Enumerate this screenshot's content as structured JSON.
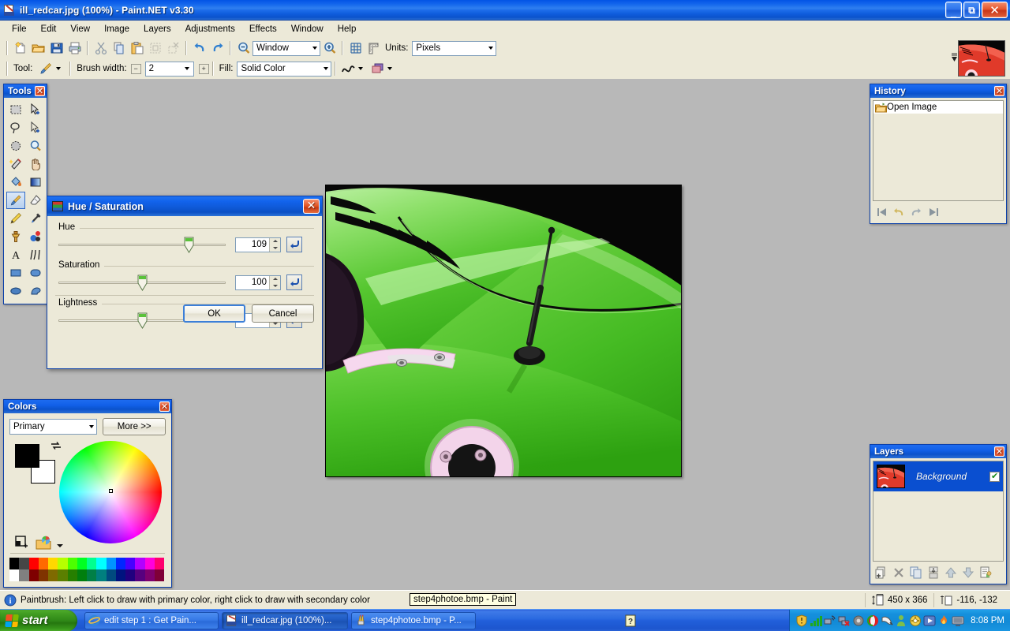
{
  "window": {
    "title": "ill_redcar.jpg (100%) - Paint.NET v3.30",
    "icon": "paintdotnet-icon",
    "minimize_label": "_",
    "maximize_label": "❐",
    "close_label": "✕"
  },
  "menu": {
    "items": [
      {
        "label": "File"
      },
      {
        "label": "Edit"
      },
      {
        "label": "View"
      },
      {
        "label": "Image"
      },
      {
        "label": "Layers"
      },
      {
        "label": "Adjustments"
      },
      {
        "label": "Effects"
      },
      {
        "label": "Window"
      },
      {
        "label": "Help"
      }
    ]
  },
  "toolbar_main": {
    "buttons": [
      {
        "name": "new-icon",
        "title": "New"
      },
      {
        "name": "open-icon",
        "title": "Open"
      },
      {
        "name": "save-icon",
        "title": "Save"
      },
      {
        "name": "print-icon",
        "title": "Print"
      },
      {
        "name": "cut-icon",
        "title": "Cut"
      },
      {
        "name": "copy-icon",
        "title": "Copy"
      },
      {
        "name": "paste-icon",
        "title": "Paste"
      },
      {
        "name": "crop-icon",
        "title": "Crop to Selection"
      },
      {
        "name": "deselect-icon",
        "title": "Deselect"
      },
      {
        "name": "undo-icon",
        "title": "Undo"
      },
      {
        "name": "redo-icon",
        "title": "Redo"
      }
    ],
    "zoom_out_icon": "zoom-out-icon",
    "zoom_in_icon": "zoom-in-icon",
    "zoom_value": "Window",
    "grid_icon": "grid-icon",
    "ruler_icon": "ruler-icon",
    "units_label": "Units:",
    "units_value": "Pixels"
  },
  "toolbar_tool": {
    "tool_label": "Tool:",
    "tool_icon": "paintbrush-icon",
    "brush_width_label": "Brush width:",
    "brush_width_value": "2",
    "decrease_label": "−",
    "increase_label": "+",
    "fill_label": "Fill:",
    "fill_value": "Solid Color",
    "antialias_icon": "antialiasing-icon",
    "blend_icon": "blend-mode-icon"
  },
  "tools_palette": {
    "title": "Tools",
    "close_label": "✕",
    "selected_tool": "paintbrush",
    "tools": [
      {
        "name": "rectangle-select-icon",
        "label": "Rectangle Select"
      },
      {
        "name": "move-selected-icon",
        "label": "Move Selected"
      },
      {
        "name": "lasso-select-icon",
        "label": "Lasso Select"
      },
      {
        "name": "move-selection-icon",
        "label": "Move Selection"
      },
      {
        "name": "ellipse-select-icon",
        "label": "Ellipse Select"
      },
      {
        "name": "zoom-icon",
        "label": "Zoom"
      },
      {
        "name": "magic-wand-icon",
        "label": "Magic Wand"
      },
      {
        "name": "pan-icon",
        "label": "Pan"
      },
      {
        "name": "paint-bucket-icon",
        "label": "Paint Bucket"
      },
      {
        "name": "gradient-icon",
        "label": "Gradient"
      },
      {
        "name": "paintbrush-icon",
        "label": "Paintbrush"
      },
      {
        "name": "eraser-icon",
        "label": "Eraser"
      },
      {
        "name": "pencil-icon",
        "label": "Pencil"
      },
      {
        "name": "color-picker-icon",
        "label": "Color Picker"
      },
      {
        "name": "clone-stamp-icon",
        "label": "Clone Stamp"
      },
      {
        "name": "recolor-icon",
        "label": "Recolor"
      },
      {
        "name": "text-icon",
        "label": "Text"
      },
      {
        "name": "line-curve-icon",
        "label": "Line / Curve"
      },
      {
        "name": "rectangle-icon",
        "label": "Rectangle"
      },
      {
        "name": "rounded-rectangle-icon",
        "label": "Rounded Rectangle"
      },
      {
        "name": "ellipse-icon",
        "label": "Ellipse"
      },
      {
        "name": "freeform-shape-icon",
        "label": "Freeform Shape"
      }
    ]
  },
  "colors_palette": {
    "title": "Colors",
    "close_label": "✕",
    "mode_value": "Primary",
    "more_label": "More >>",
    "primary_color": "#000000",
    "secondary_color": "#ffffff",
    "swap_icon": "swap-colors-icon",
    "reset_icon": "reset-colors-icon",
    "add_palette_icon": "add-to-palette-icon",
    "open_palette_icon": "open-palette-icon",
    "swatches_row1": [
      "#000000",
      "#464646",
      "#ff0000",
      "#ff6a00",
      "#ffd800",
      "#b6ff00",
      "#4cff00",
      "#00ff21",
      "#00ff90",
      "#00ffff",
      "#0094ff",
      "#0026ff",
      "#4800ff",
      "#b200ff",
      "#ff00dc",
      "#ff006e"
    ],
    "swatches_row2": [
      "#ffffff",
      "#808080",
      "#7f0000",
      "#7f3300",
      "#7f6a00",
      "#5b7f00",
      "#267f00",
      "#007f0e",
      "#007f46",
      "#007f7f",
      "#004a7f",
      "#00137f",
      "#21007f",
      "#57007f",
      "#7f006e",
      "#7f0037"
    ]
  },
  "history_palette": {
    "title": "History",
    "close_label": "✕",
    "items": [
      {
        "label": "Open Image",
        "icon": "open-image-icon",
        "selected": true
      }
    ],
    "buttons": [
      {
        "name": "history-rewind-icon"
      },
      {
        "name": "history-undo-icon"
      },
      {
        "name": "history-redo-icon"
      },
      {
        "name": "history-forward-icon"
      }
    ]
  },
  "layers_palette": {
    "title": "Layers",
    "close_label": "✕",
    "layers": [
      {
        "name": "Background",
        "visible": true,
        "selected": true
      }
    ],
    "buttons": [
      {
        "name": "add-layer-icon"
      },
      {
        "name": "delete-layer-icon"
      },
      {
        "name": "duplicate-layer-icon"
      },
      {
        "name": "merge-layer-down-icon"
      },
      {
        "name": "move-layer-up-icon"
      },
      {
        "name": "move-layer-down-icon"
      },
      {
        "name": "layer-properties-icon"
      }
    ]
  },
  "huesat_dialog": {
    "title": "Hue / Saturation",
    "icon": "hue-saturation-icon",
    "close_label": "✕",
    "sliders": [
      {
        "label": "Hue",
        "value": "109",
        "min": -180,
        "max": 180,
        "pos_pct": 80
      },
      {
        "label": "Saturation",
        "value": "100",
        "min": 0,
        "max": 200,
        "pos_pct": 50
      },
      {
        "label": "Lightness",
        "value": "0",
        "min": -100,
        "max": 100,
        "pos_pct": 50
      }
    ],
    "reset_icon": "reset-arrow-icon",
    "ok_label": "OK",
    "cancel_label": "Cancel"
  },
  "statusbar": {
    "help_icon": "info-icon",
    "message": "Paintbrush: Left click to draw with primary color, right click to draw with secondary color",
    "size_icon": "image-size-icon",
    "size_text": "450 x 366",
    "cursor_icon": "cursor-position-icon",
    "cursor_text": "-116, -132"
  },
  "tooltip": {
    "text": "step4photoe.bmp - Paint"
  },
  "taskbar": {
    "start_label": "start",
    "tasks": [
      {
        "label": "edit step 1 : Get Pain...",
        "icon": "internet-explorer-icon",
        "active": false
      },
      {
        "label": "ill_redcar.jpg (100%)...",
        "icon": "paintdotnet-icon",
        "active": true
      },
      {
        "label": "step4photoe.bmp - P...",
        "icon": "mspaint-icon",
        "active": false
      }
    ],
    "notify_arrow_icon": "show-hidden-icons-icon",
    "tray_icons": [
      {
        "name": "security-shield-icon"
      },
      {
        "name": "signal-bars-icon"
      },
      {
        "name": "network-wireless-icon"
      },
      {
        "name": "network-disconnected-icon"
      },
      {
        "name": "volume-icon"
      },
      {
        "name": "opera-icon"
      },
      {
        "name": "mouse-icon"
      },
      {
        "name": "user-icon"
      },
      {
        "name": "phone-icon"
      },
      {
        "name": "media-icon"
      },
      {
        "name": "flame-icon"
      },
      {
        "name": "display-icon"
      }
    ],
    "clock": "8:08 PM"
  },
  "canvas": {
    "image_name": "ill_redcar.jpg",
    "description": "green sports car hood with antenna"
  }
}
